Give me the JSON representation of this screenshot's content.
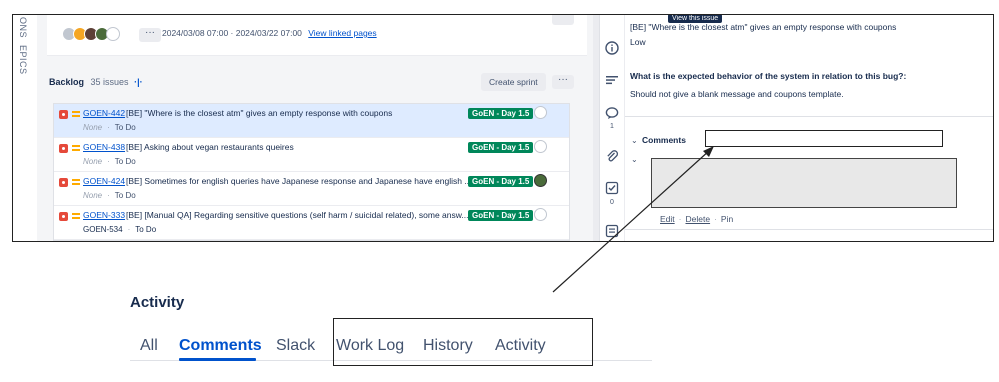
{
  "left_rail": {
    "labels": [
      "ONS",
      "EPICS"
    ]
  },
  "sprint": {
    "dates": "2024/03/08 07:00 · 2024/03/22 07:00",
    "linked_pages": "View linked pages",
    "more": "···"
  },
  "backlog": {
    "title": "Backlog",
    "count": "35 issues",
    "create_sprint": "Create sprint",
    "more": "···",
    "issues": [
      {
        "key": "GOEN-442",
        "summary": "[BE] \"Where is the closest atm\" gives an empty response with coupons",
        "sub_left": "None",
        "status": "To Do",
        "label": "GoEN - Day 1.5"
      },
      {
        "key": "GOEN-438",
        "summary": "[BE] Asking about vegan restaurants queires",
        "sub_left": "None",
        "status": "To Do",
        "label": "GoEN - Day 1.5"
      },
      {
        "key": "GOEN-424",
        "summary": "[BE] Sometimes for english queries have Japanese response and Japanese have english ...",
        "sub_left": "None",
        "status": "To Do",
        "label": "GoEN - Day 1.5"
      },
      {
        "key": "GOEN-333",
        "summary": "[BE] [Manual QA] Regarding sensitive questions (self harm / suicidal related), some answ...",
        "sub_left": "GOEN-534",
        "status": "To Do",
        "label": "GoEN - Day 1.5"
      }
    ]
  },
  "icon_rail": {
    "comment_count": "1",
    "checklist_count": "0"
  },
  "detail": {
    "tooltip": "View this issue",
    "line1": "[BE] \"Where is the closest atm\" gives an empty response with coupons",
    "priority": "Low",
    "question": "What is the expected behavior of the system in relation to this bug?:",
    "answer": "Should not give a blank message and coupons template.",
    "comments_label": "Comments",
    "edit": "Edit",
    "delete": "Delete",
    "pin": "Pin"
  },
  "activity": {
    "title": "Activity",
    "tabs": [
      "All",
      "Comments",
      "Slack",
      "Work Log",
      "History",
      "Activity"
    ]
  }
}
